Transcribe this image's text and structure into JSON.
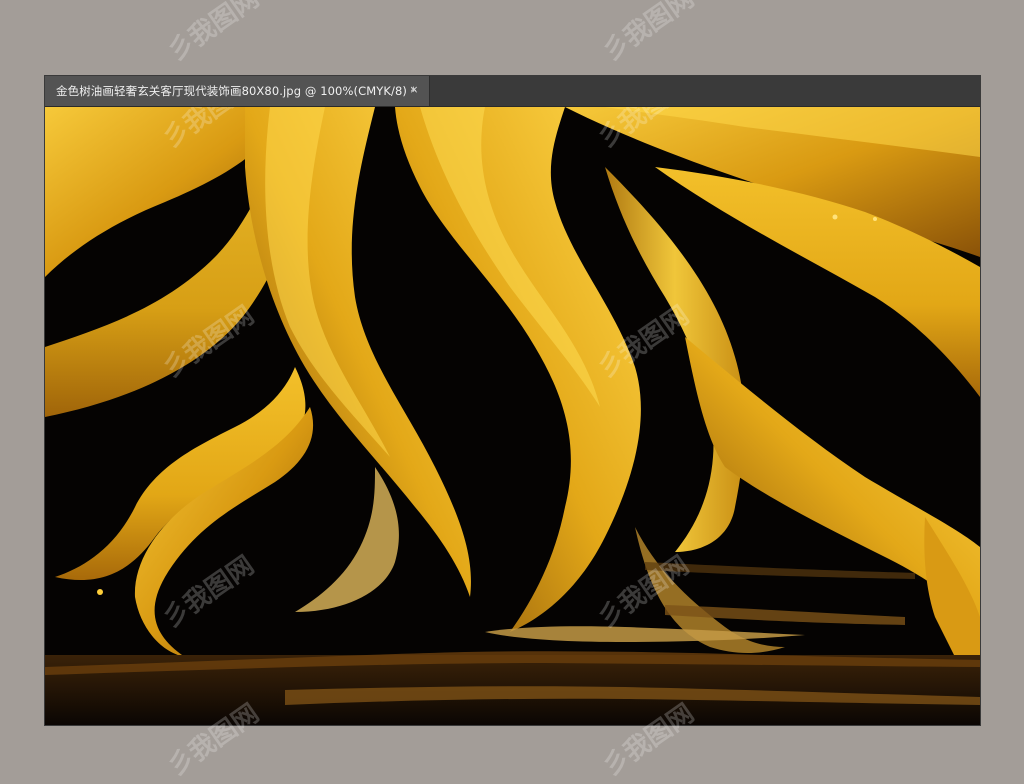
{
  "document": {
    "tab_title": "金色树油画轻奢玄关客厅现代装饰画80X80.jpg @ 100%(CMYK/8) *",
    "close_glyph": "×"
  },
  "watermark": {
    "text": "彡我图网"
  },
  "colors": {
    "workspace_bg": "#a39d98",
    "tab_bg": "#535353",
    "tabbar_bg": "#3a3a3a",
    "artwork_gold": "#e8b21c",
    "artwork_dark": "#050302"
  },
  "icons": {
    "tab_close": "close-icon"
  }
}
